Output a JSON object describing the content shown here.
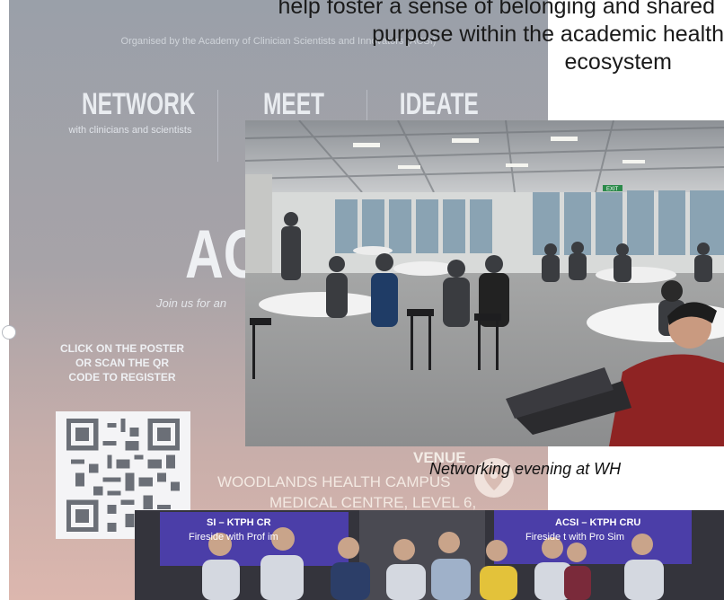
{
  "headline": {
    "line1": "help foster a sense of belonging and shared",
    "line2": "purpose within the academic health",
    "line3": "ecosystem"
  },
  "poster": {
    "organised_by": "Organised by the Academy of Clinician Scientists and Innovators (ACSI)",
    "pillars": [
      {
        "title": "NETWORK",
        "subtitle": "with clinicians and scientists"
      },
      {
        "title": "MEET",
        "subtitle": ""
      },
      {
        "title": "IDEATE",
        "subtitle": ""
      }
    ],
    "acsi_title": "AC",
    "join_text": "Join us for an",
    "cta": "CLICK ON THE POSTER OR SCAN THE QR CODE TO REGISTER",
    "venue_label": "VENUE",
    "venue_line1": "WOODLANDS HEALTH CAMPUS",
    "venue_line2": "MEDICAL CENTRE, LEVEL 6,"
  },
  "photo1": {
    "caption": "Networking evening at WH",
    "exit_sign": "EXIT"
  },
  "photo2": {
    "banner_left": "SI – KTPH CR",
    "banner_left_sub": "Fireside       with Prof     im",
    "banner_right": "ACSI – KTPH CRU",
    "banner_right_sub": "Fireside      t with Pro       Sim"
  },
  "colors": {
    "poster_top": "#9aa0a9",
    "poster_bottom": "#dcb7ae",
    "banner_purple": "#4b3ea8",
    "text": "#1a1a1a"
  }
}
